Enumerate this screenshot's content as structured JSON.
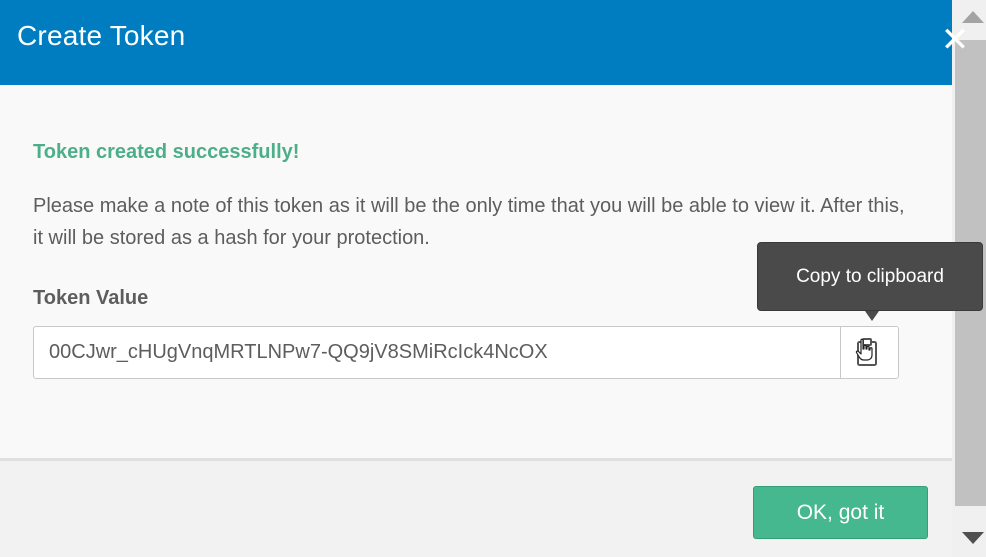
{
  "dialog": {
    "title": "Create Token",
    "close_glyph": "✕",
    "close_icon": "close-icon"
  },
  "content": {
    "success_message": "Token created successfully!",
    "description": "Please make a note of this token as it will be the only time that you will be able to view it. After this, it will be stored as a hash for your protection.",
    "token_label": "Token Value",
    "token_value": "00CJwr_cHUgVnqMRTLNPw7-QQ9jV8SMiRcIck4NcOX",
    "copy_icon": "clipboard-icon",
    "tooltip": "Copy to clipboard"
  },
  "footer": {
    "ok_label": "OK, got it"
  },
  "colors": {
    "header": "#007cc0",
    "success": "#4caf89",
    "ok_button": "#46b88f",
    "tooltip": "#4a4a4a"
  }
}
